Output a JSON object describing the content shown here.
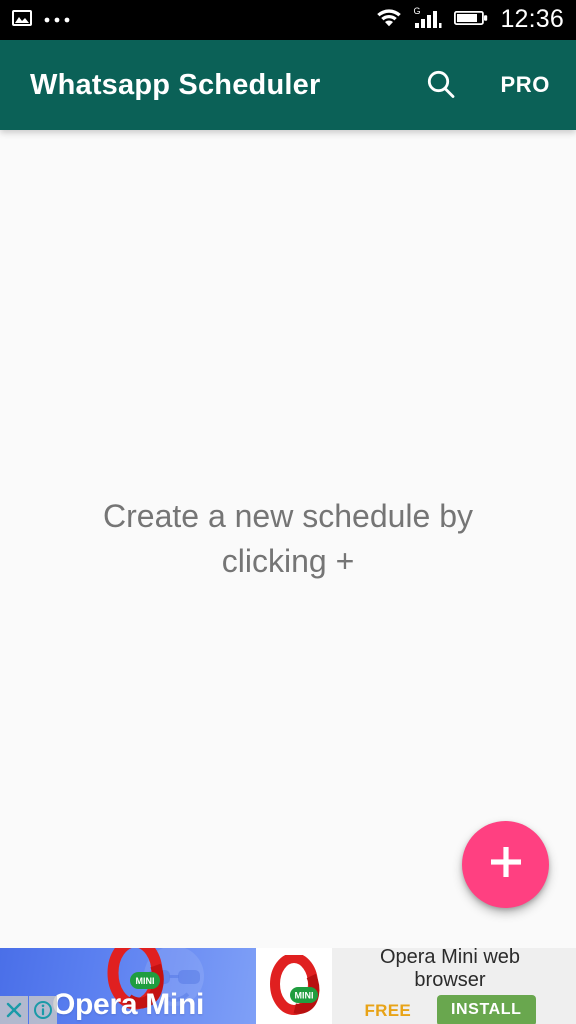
{
  "status_bar": {
    "icons": [
      "image-icon",
      "more-notifications-icon",
      "wifi-icon",
      "signal-icon",
      "battery-icon"
    ],
    "network_type": "G",
    "time": "12:36",
    "background_color": "#000000"
  },
  "app_bar": {
    "title": "Whatsapp Scheduler",
    "background_color": "#0B6157",
    "search_label": "search-icon",
    "pro_label": "PRO"
  },
  "content": {
    "empty_state_text": "Create a new schedule by clicking +",
    "background_color": "#FAFAFA",
    "text_color": "#757575"
  },
  "fab": {
    "label": "+",
    "icon": "plus-icon",
    "color": "#FF4081"
  },
  "ad": {
    "creative_title": "Opera Mini",
    "headline": "Opera Mini web browser",
    "price": "FREE",
    "install_label": "INSTALL",
    "badge": "MINI",
    "close_label": "×",
    "info_label": "i",
    "install_color": "#69A74E",
    "price_color": "#E8A317"
  }
}
